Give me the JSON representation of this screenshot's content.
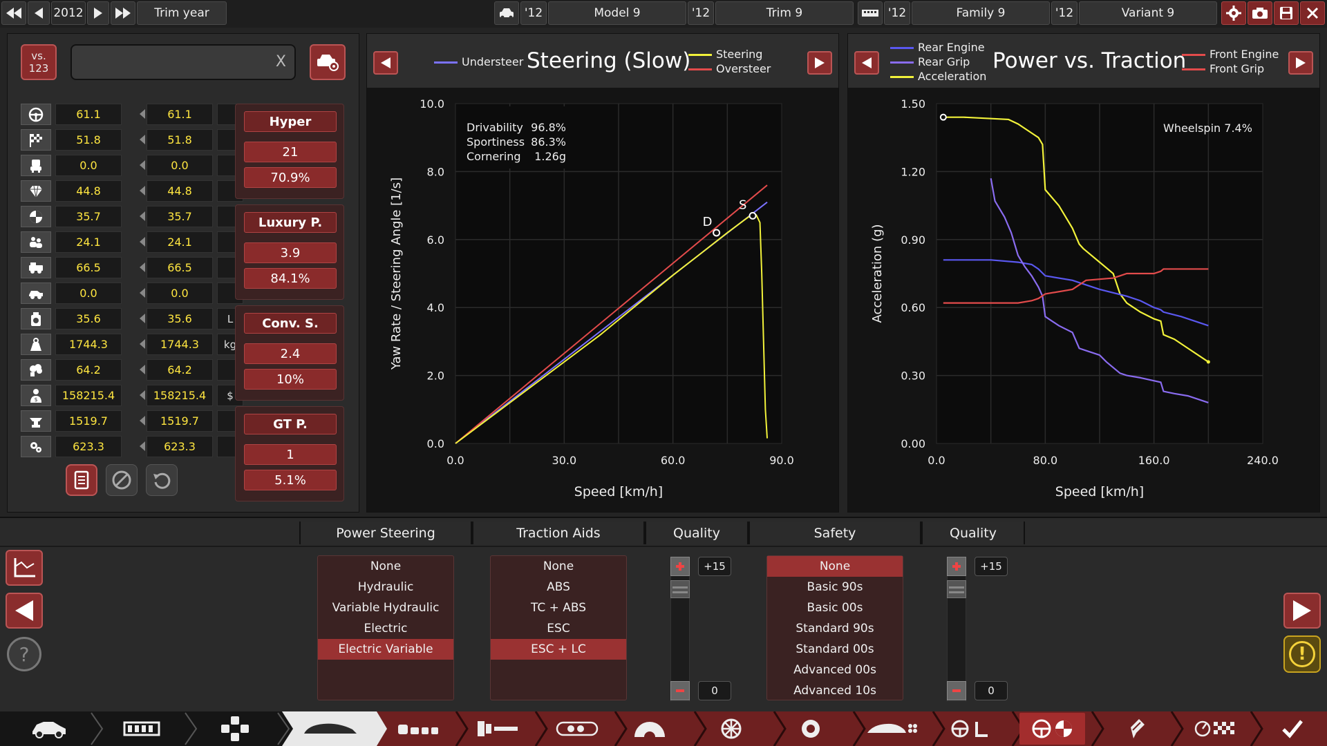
{
  "topbar": {
    "year": "2012",
    "trim_year_btn": "Trim year",
    "model_year": "'12",
    "model": "Model 9",
    "trim_year": "'12",
    "trim": "Trim 9",
    "family_year": "'12",
    "family": "Family 9",
    "variant_year": "'12",
    "variant": "Variant 9"
  },
  "compare": {
    "vs_label": "vs.",
    "vs_value": "123",
    "search_value": "",
    "clear": "X"
  },
  "stats": [
    {
      "icon": "steering-wheel-icon",
      "a": "61.1",
      "b": "61.1",
      "unit": ""
    },
    {
      "icon": "checkered-flag-icon",
      "a": "51.8",
      "b": "51.8",
      "unit": ""
    },
    {
      "icon": "seat-icon",
      "a": "0.0",
      "b": "0.0",
      "unit": ""
    },
    {
      "icon": "diamond-icon",
      "a": "44.8",
      "b": "44.8",
      "unit": ""
    },
    {
      "icon": "crash-test-icon",
      "a": "35.7",
      "b": "35.7",
      "unit": ""
    },
    {
      "icon": "people-icon",
      "a": "24.1",
      "b": "24.1",
      "unit": ""
    },
    {
      "icon": "utility-vehicle-icon",
      "a": "66.5",
      "b": "66.5",
      "unit": ""
    },
    {
      "icon": "offroad-icon",
      "a": "0.0",
      "b": "0.0",
      "unit": ""
    },
    {
      "icon": "fuel-can-icon",
      "a": "35.6",
      "b": "35.6",
      "unit": "L"
    },
    {
      "icon": "weight-icon",
      "a": "1744.3",
      "b": "1744.3",
      "unit": "kg"
    },
    {
      "icon": "emissions-icon",
      "a": "64.2",
      "b": "64.2",
      "unit": ""
    },
    {
      "icon": "cost-icon",
      "a": "158215.4",
      "b": "158215.4",
      "unit": "$"
    },
    {
      "icon": "anvil-icon",
      "a": "1519.7",
      "b": "1519.7",
      "unit": ""
    },
    {
      "icon": "service-gear-icon",
      "a": "623.3",
      "b": "623.3",
      "unit": ""
    }
  ],
  "classes": [
    {
      "name": "Hyper",
      "rank": "21",
      "pct": "70.9%"
    },
    {
      "name": "Luxury P.",
      "rank": "3.9",
      "pct": "84.1%"
    },
    {
      "name": "Conv. S.",
      "rank": "2.4",
      "pct": "10%"
    },
    {
      "name": "GT P.",
      "rank": "1",
      "pct": "5.1%"
    }
  ],
  "steering_panel": {
    "title": "Steering (Slow)",
    "legend_understeer": "Understeer",
    "legend_steering": "Steering",
    "legend_oversteer": "Oversteer"
  },
  "traction_panel": {
    "title": "Power vs. Traction",
    "legend_rear_engine": "Rear Engine",
    "legend_rear_grip": "Rear Grip",
    "legend_acceleration": "Acceleration",
    "legend_front_engine": "Front Engine",
    "legend_front_grip": "Front Grip"
  },
  "colors": {
    "understeer": "#7b72ff",
    "steering": "#f2f23a",
    "oversteer": "#e34b4b",
    "rear_engine": "#5a58f0",
    "rear_grip": "#8a6cf0",
    "acceleration": "#f2f23a",
    "front_engine": "#e34b4b",
    "front_grip": "#e34b4b",
    "accent_red": "#8a2b2b"
  },
  "chart_data": [
    {
      "type": "line",
      "title": "Steering (Slow)",
      "xlabel": "Speed [km/h]",
      "ylabel": "Yaw Rate / Steering Angle [1/s]",
      "xlim": [
        0,
        90
      ],
      "ylim": [
        0,
        10
      ],
      "xticks": [
        "0.0",
        "30.0",
        "60.0",
        "90.0"
      ],
      "yticks": [
        "0.0",
        "2.0",
        "4.0",
        "6.0",
        "8.0",
        "10.0"
      ],
      "stats": [
        {
          "label": "Drivability",
          "value": "96.8%"
        },
        {
          "label": "Sportiness",
          "value": "86.3%"
        },
        {
          "label": "Cornering",
          "value": "1.26g"
        }
      ],
      "markers": [
        {
          "label": "D",
          "x": 72,
          "y": 6.2
        },
        {
          "label": "S",
          "x": 82,
          "y": 6.7
        }
      ],
      "series": [
        {
          "name": "Understeer",
          "x": [
            0,
            86
          ],
          "y": [
            0,
            7.1
          ]
        },
        {
          "name": "Oversteer",
          "x": [
            0,
            86
          ],
          "y": [
            0,
            7.6
          ]
        },
        {
          "name": "Steering",
          "x": [
            0,
            20,
            40,
            60,
            75,
            80,
            82,
            83,
            84,
            84.5,
            85,
            85.5,
            86
          ],
          "y": [
            0,
            1.6,
            3.2,
            4.95,
            6.2,
            6.6,
            6.75,
            6.72,
            6.5,
            5.0,
            3.0,
            1.0,
            0.15
          ]
        }
      ]
    },
    {
      "type": "line",
      "title": "Power vs. Traction",
      "xlabel": "Speed [km/h]",
      "ylabel": "Acceleration (g)",
      "xlim": [
        0,
        240
      ],
      "ylim": [
        0,
        1.5
      ],
      "xticks": [
        "0.0",
        "80.0",
        "160.0",
        "240.0"
      ],
      "yticks": [
        "0.00",
        "0.30",
        "0.60",
        "0.90",
        "1.20",
        "1.50"
      ],
      "annotation": "Wheelspin 7.4%",
      "series": [
        {
          "name": "Acceleration",
          "x": [
            5,
            20,
            53,
            60,
            70,
            75,
            78,
            80,
            90,
            100,
            105,
            108,
            110,
            120,
            130,
            135,
            140,
            150,
            160,
            165,
            167,
            175,
            185,
            200
          ],
          "y": [
            1.44,
            1.44,
            1.43,
            1.41,
            1.37,
            1.35,
            1.32,
            1.12,
            1.05,
            0.95,
            0.88,
            0.86,
            0.85,
            0.8,
            0.75,
            0.66,
            0.62,
            0.58,
            0.55,
            0.54,
            0.48,
            0.46,
            0.42,
            0.36
          ]
        },
        {
          "name": "Rear Engine",
          "x": [
            5,
            40,
            60,
            70,
            75,
            80,
            100,
            110,
            120,
            140,
            150,
            160,
            165,
            167,
            180,
            200
          ],
          "y": [
            0.81,
            0.81,
            0.8,
            0.79,
            0.77,
            0.74,
            0.72,
            0.7,
            0.68,
            0.65,
            0.63,
            0.6,
            0.59,
            0.58,
            0.56,
            0.52
          ]
        },
        {
          "name": "Rear Grip",
          "x": [
            40,
            43,
            50,
            55,
            60,
            65,
            70,
            75,
            78,
            80,
            90,
            100,
            105,
            110,
            120,
            125,
            135,
            140,
            150,
            165,
            167,
            175,
            185,
            200
          ],
          "y": [
            1.17,
            1.07,
            1.0,
            0.93,
            0.83,
            0.78,
            0.74,
            0.69,
            0.65,
            0.56,
            0.52,
            0.49,
            0.42,
            0.41,
            0.39,
            0.36,
            0.31,
            0.3,
            0.29,
            0.27,
            0.23,
            0.22,
            0.21,
            0.18
          ]
        },
        {
          "name": "Front Engine",
          "x": [
            5,
            40,
            60,
            70,
            75,
            80,
            100,
            105,
            110,
            130,
            135,
            140,
            160,
            165,
            167,
            180,
            200
          ],
          "y": [
            0.62,
            0.62,
            0.62,
            0.63,
            0.64,
            0.66,
            0.68,
            0.7,
            0.72,
            0.73,
            0.74,
            0.75,
            0.75,
            0.76,
            0.77,
            0.77,
            0.77
          ]
        }
      ]
    }
  ],
  "bottom": {
    "power_steering": {
      "header": "Power Steering",
      "options": [
        "None",
        "Hydraulic",
        "Variable Hydraulic",
        "Electric",
        "Electric Variable"
      ],
      "selected": 4
    },
    "traction_aids": {
      "header": "Traction Aids",
      "options": [
        "None",
        "ABS",
        "TC + ABS",
        "ESC",
        "ESC + LC"
      ],
      "selected": 4
    },
    "quality1": {
      "header": "Quality",
      "top": "+15",
      "bottom": "0"
    },
    "safety": {
      "header": "Safety",
      "options": [
        "None",
        "Basic 90s",
        "Basic 00s",
        "Standard 90s",
        "Standard 00s",
        "Advanced 00s",
        "Advanced 10s"
      ],
      "selected": 0
    },
    "quality2": {
      "header": "Quality",
      "top": "+15",
      "bottom": "0"
    },
    "help": "?",
    "warning": "!"
  }
}
